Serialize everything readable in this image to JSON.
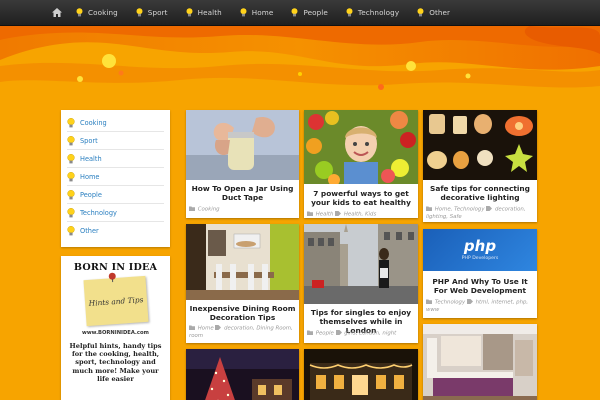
{
  "nav": {
    "home_icon": "home-icon",
    "items": [
      {
        "label": "Cooking",
        "icon": "lightbulb-icon"
      },
      {
        "label": "Sport",
        "icon": "lightbulb-icon"
      },
      {
        "label": "Health",
        "icon": "lightbulb-icon"
      },
      {
        "label": "Home",
        "icon": "lightbulb-icon"
      },
      {
        "label": "People",
        "icon": "lightbulb-icon"
      },
      {
        "label": "Technology",
        "icon": "lightbulb-icon"
      },
      {
        "label": "Other",
        "icon": "lightbulb-icon"
      }
    ]
  },
  "sidebar": {
    "categories": [
      {
        "label": "Cooking"
      },
      {
        "label": "Sport"
      },
      {
        "label": "Health"
      },
      {
        "label": "Home"
      },
      {
        "label": "People"
      },
      {
        "label": "Technology"
      },
      {
        "label": "Other"
      }
    ],
    "promo": {
      "logo": "BORN IN IDEA",
      "note": "Hints and Tips",
      "url": "www.BORNINIDEA.com",
      "desc": "Helpful hints, handy tips for the cooking, health, sport, technology and much more! Make your life easier"
    }
  },
  "posts": [
    {
      "title": "How To Open a Jar Using Duct Tape",
      "meta_cats": "Cooking",
      "meta_tags": ""
    },
    {
      "title": "7 powerful ways to get your kids to eat healthy",
      "meta_cats": "Health",
      "meta_tags": "Health, Kids"
    },
    {
      "title": "Safe tips for connecting decorative lighting",
      "meta_cats": "Home, Technology",
      "meta_tags": "decoration, lighting, Safe"
    },
    {
      "title": "Inexpensive Dining Room Decoration Tips",
      "meta_cats": "Home",
      "meta_tags": "decoration, Dining Room, room"
    },
    {
      "title": "Tips for singles to enjoy themselves while in London",
      "meta_cats": "People",
      "meta_tags": "girls, London, night"
    },
    {
      "title": "PHP And Why To Use It For Web Development",
      "meta_cats": "Technology",
      "meta_tags": "html, internet, php, www"
    },
    {
      "title": "",
      "meta_cats": "",
      "meta_tags": ""
    },
    {
      "title": "",
      "meta_cats": "",
      "meta_tags": ""
    },
    {
      "title": "",
      "meta_cats": "",
      "meta_tags": ""
    }
  ],
  "thumbs": {
    "php_logo": "php",
    "php_sub": "PHP Developers"
  },
  "colors": {
    "background": "#f7a400",
    "nav_bar": "#262626",
    "link_blue": "#2a7fc0",
    "bulb_yellow": "#ffd21a"
  }
}
